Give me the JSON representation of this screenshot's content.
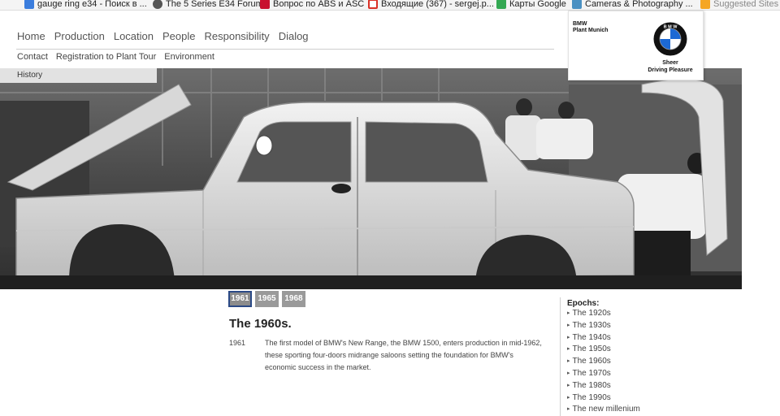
{
  "bookmarks": [
    {
      "label": "gauge ring e34 - Поиск в ...",
      "icon": "google-icon",
      "color": "#3b7ddd"
    },
    {
      "label": "The 5 Series E34 Forum",
      "icon": "forum-icon",
      "color": "#555555"
    },
    {
      "label": "Вопрос по ABS и ASC",
      "icon": "drive2-icon",
      "color": "#c8102e"
    },
    {
      "label": "Входящие (367) - sergej.p...",
      "icon": "gmail-icon",
      "color": "#d93025"
    },
    {
      "label": "Карты Google",
      "icon": "maps-icon",
      "color": "#34a853"
    },
    {
      "label": "Cameras & Photography ...",
      "icon": "camera-icon",
      "color": "#4a90c2"
    },
    {
      "label": "Suggested Sites",
      "icon": "suggested-icon",
      "color": "#f5a623"
    }
  ],
  "nav": {
    "main": [
      "Home",
      "Production",
      "Location",
      "People",
      "Responsibility",
      "Dialog"
    ],
    "sub": [
      "Contact",
      "Registration to Plant Tour",
      "Environment"
    ],
    "history": "History"
  },
  "brand": {
    "plant_line1": "BMW",
    "plant_line2": "Plant Munich",
    "slogan_line1": "Sheer",
    "slogan_line2": "Driving Pleasure",
    "roundel_text": "B M W"
  },
  "years": [
    "1961",
    "1965",
    "1968"
  ],
  "active_year": "1961",
  "content": {
    "title": "The 1960s.",
    "entry_year": "1961",
    "entry_text": "The first model of BMW's New Range, the BMW 1500, enters production in mid-1962, these sporting four-doors midrange saloons setting the foundation for BMW's economic success in the market."
  },
  "epochs": {
    "title": "Epochs:",
    "items": [
      "The 1920s",
      "The 1930s",
      "The 1940s",
      "The 1950s",
      "The 1960s",
      "The 1970s",
      "The 1980s",
      "The 1990s",
      "The new millenium"
    ]
  },
  "colors": {
    "accent": "#2b4a86",
    "tab_gray": "#9a9a9a"
  }
}
